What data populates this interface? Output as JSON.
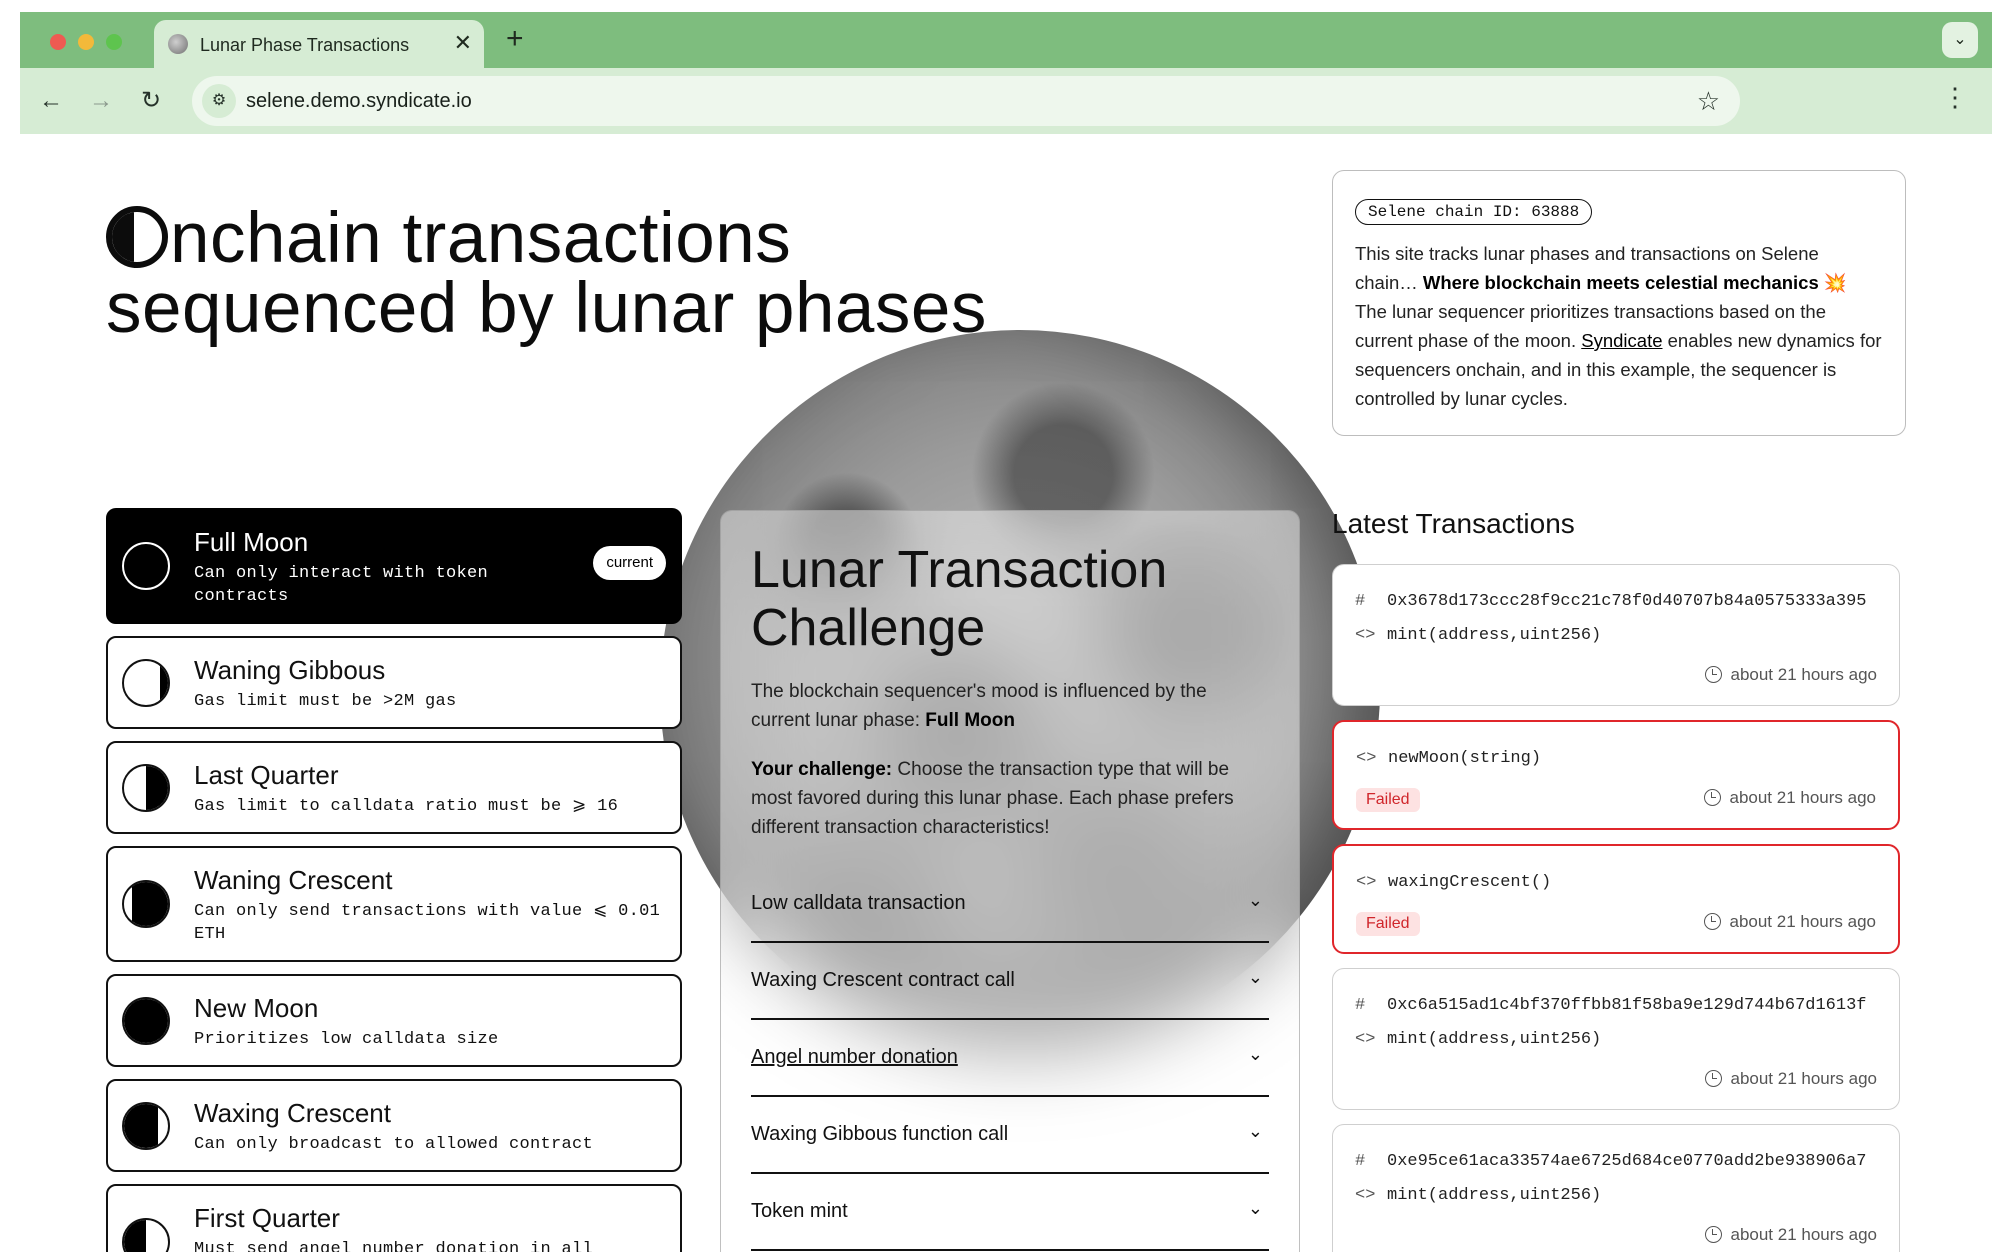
{
  "browser": {
    "tab_title": "Lunar Phase Transactions",
    "tab_close": "✕",
    "new_tab": "+",
    "menu_chevron": "⌄",
    "url": "selene.demo.syndicate.io",
    "icons": [
      "back-icon",
      "forward-icon",
      "reload-icon",
      "site-settings-icon",
      "bookmark-star-icon",
      "browser-menu-icon"
    ]
  },
  "hero": {
    "line1_rest": "nchain transactions",
    "line2": "sequenced by lunar phases"
  },
  "phases": [
    {
      "name": "Full Moon",
      "desc": "Can only interact with token contracts",
      "badge": "current"
    },
    {
      "name": "Waning Gibbous",
      "desc": "Gas limit must be >2M gas"
    },
    {
      "name": "Last Quarter",
      "desc": "Gas limit to calldata ratio must be ⩾ 16"
    },
    {
      "name": "Waning Crescent",
      "desc": "Can only send transactions with value ⩽ 0.01 ETH"
    },
    {
      "name": "New Moon",
      "desc": "Prioritizes low calldata size"
    },
    {
      "name": "Waxing Crescent",
      "desc": "Can only broadcast to allowed contract"
    },
    {
      "name": "First Quarter",
      "desc": "Must send angel number donation in all transactions"
    }
  ],
  "challenge": {
    "title": "Lunar Transaction Challenge",
    "intro": "The blockchain sequencer's mood is influenced by the current lunar phase: ",
    "intro_phase": "Full Moon",
    "challenge_label": "Your challenge:",
    "challenge_text": " Choose the transaction type that will be most favored during this lunar phase. Each phase prefers different transaction characteristics!",
    "options": [
      "Low calldata transaction",
      "Waxing Crescent contract call",
      "Angel number donation",
      "Waxing Gibbous function call",
      "Token mint"
    ]
  },
  "info": {
    "chain_id": "Selene chain ID: 63888",
    "text_a": "This site tracks lunar phases and transactions on Selene chain… ",
    "text_bold": "Where blockchain meets celestial mechanics",
    "sparkle": "💥",
    "text_b": " The lunar sequencer prioritizes transactions based on the current phase of the moon. ",
    "link": "Syndicate",
    "text_c": " enables new dynamics for sequencers onchain, and in this example, the sequencer is controlled by lunar cycles."
  },
  "transactions": {
    "heading": "Latest Transactions",
    "hash_symbol": "#",
    "code_symbol": "<>",
    "items": [
      {
        "hash": "0x3678d173ccc28f9cc21c78f0d40707b84a0575333a395",
        "method": "mint(address,uint256)",
        "time": "about 21 hours ago"
      },
      {
        "method": "newMoon(string)",
        "status": "Failed",
        "time": "about 21 hours ago"
      },
      {
        "method": "waxingCrescent()",
        "status": "Failed",
        "time": "about 21 hours ago"
      },
      {
        "hash": "0xc6a515ad1c4bf370ffbb81f58ba9e129d744b67d1613f",
        "method": "mint(address,uint256)",
        "time": "about 21 hours ago"
      },
      {
        "hash": "0xe95ce61aca33574ae6725d684ce0770add2be938906a7",
        "method": "mint(address,uint256)",
        "time": "about 21 hours ago"
      }
    ]
  },
  "colors": {
    "chrome_green": "#7ebd7e",
    "chrome_light": "#d6ecd4",
    "failed_red": "#e0262b"
  }
}
